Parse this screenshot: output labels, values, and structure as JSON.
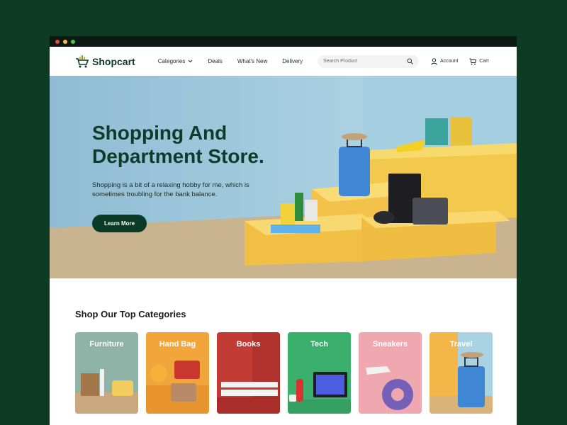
{
  "brand": {
    "name": "Shopcart"
  },
  "nav": {
    "items": [
      {
        "label": "Categories",
        "has_dropdown": true
      },
      {
        "label": "Deals"
      },
      {
        "label": "What's New"
      },
      {
        "label": "Delivery"
      }
    ],
    "search_placeholder": "Search Product",
    "account_label": "Account",
    "cart_label": "Cart"
  },
  "hero": {
    "title_line1": "Shopping And",
    "title_line2": "Department Store.",
    "subtitle": "Shopping is a bit of a relaxing hobby for me, which is sometimes troubling for the bank balance.",
    "cta_label": "Learn More"
  },
  "categories": {
    "title": "Shop Our Top Categories",
    "items": [
      {
        "label": "Furniture",
        "color": "#8fb3a6"
      },
      {
        "label": "Hand Bag",
        "color": "#f2a53b"
      },
      {
        "label": "Books",
        "color": "#c23b35"
      },
      {
        "label": "Tech",
        "color": "#3bb06c"
      },
      {
        "label": "Sneakers",
        "color": "#f0a8b0"
      },
      {
        "label": "Travel",
        "color": "#f4b648"
      }
    ]
  },
  "colors": {
    "brand": "#0b3a26",
    "background": "#0e3b24",
    "hero_bg": "#a9cfe0",
    "accent_yellow": "#f5c94c"
  },
  "window_dots": [
    "#e94b3c",
    "#f5c33b",
    "#4cc74a"
  ]
}
